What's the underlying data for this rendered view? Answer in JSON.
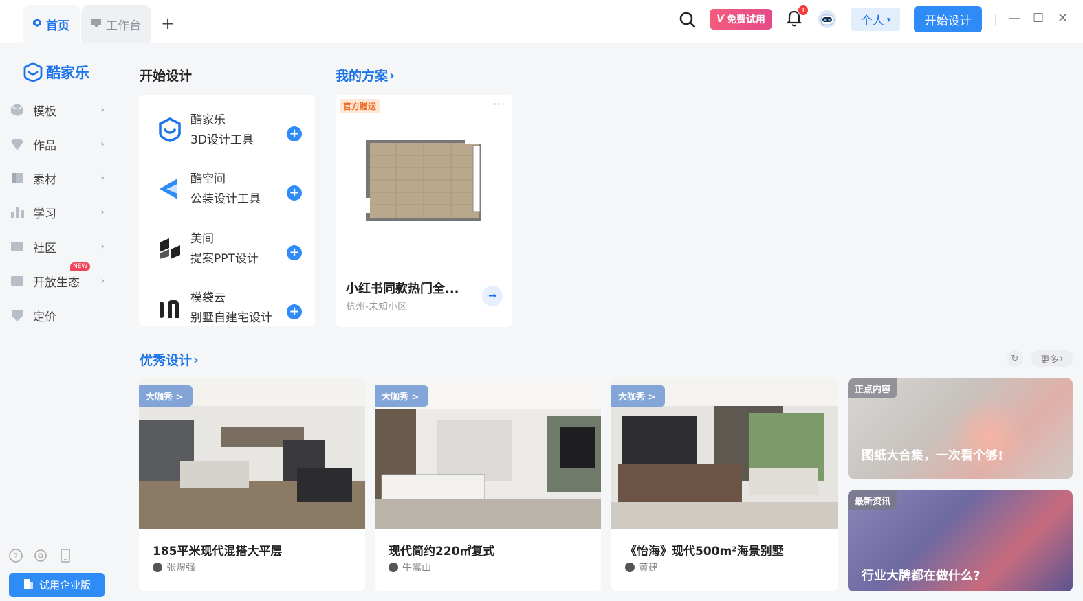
{
  "tabs": {
    "home": "首页",
    "workbench": "工作台",
    "add": "+"
  },
  "header": {
    "vip_label": "免费试用",
    "vip_v": "V",
    "bell_count": "1",
    "account_select": "个人",
    "start_design": "开始设计"
  },
  "window": {
    "minimize": "—",
    "maximize": "☐",
    "close": "✕"
  },
  "sidebar": {
    "logo": "酷家乐",
    "items": [
      {
        "label": "模板"
      },
      {
        "label": "作品"
      },
      {
        "label": "素材"
      },
      {
        "label": "学习"
      },
      {
        "label": "社区"
      },
      {
        "label": "开放生态",
        "badge": "NEW"
      },
      {
        "label": "定价"
      }
    ],
    "try_enterprise": "试用企业版"
  },
  "start_design": {
    "title": "开始设计",
    "tools": [
      {
        "name": "酷家乐",
        "desc": "3D设计工具"
      },
      {
        "name": "酷空间",
        "desc": "公装设计工具"
      },
      {
        "name": "美间",
        "desc": "提案PPT设计"
      },
      {
        "name": "模袋云",
        "desc": "别墅自建宅设计"
      }
    ]
  },
  "my_plans": {
    "title": "我的方案",
    "card": {
      "tag": "官方赠送",
      "title": "小红书同款热门全...",
      "subtitle": "杭州-未知小区"
    }
  },
  "featured": {
    "title": "优秀设计",
    "more": "更多",
    "cards": [
      {
        "badge": "大咖秀 >",
        "title": "185平米现代混搭大平层",
        "author": "张煜强"
      },
      {
        "badge": "大咖秀 >",
        "title": "现代简约220㎡复式",
        "author": "牛嵩山"
      },
      {
        "badge": "大咖秀 >",
        "title": "《怡海》现代500m²海景别墅",
        "author": "黄建"
      }
    ],
    "promos": [
      {
        "tag": "正点内容",
        "text": "图纸大合集，一次看个够!"
      },
      {
        "tag": "最新资讯",
        "text": "行业大牌都在做什么?"
      }
    ]
  },
  "colors": {
    "accent": "#2f8cf7",
    "brand": "#1a73e8",
    "vip": "#f45c7c"
  }
}
